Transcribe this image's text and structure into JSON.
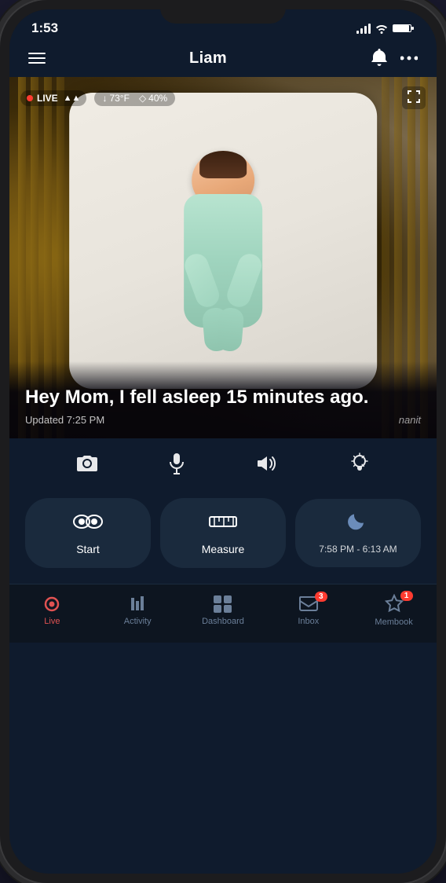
{
  "status_bar": {
    "time": "1:53",
    "signal": true,
    "wifi": true,
    "battery": true
  },
  "header": {
    "title": "Liam",
    "menu_label": "menu",
    "bell_label": "notifications",
    "more_label": "more options"
  },
  "camera": {
    "live_badge": "LIVE",
    "temperature": "73°F",
    "humidity": "40%",
    "message": "Hey Mom, I fell asleep 15 minutes ago.",
    "updated": "Updated 7:25 PM",
    "watermark": "nanit",
    "fullscreen": "fullscreen"
  },
  "controls": {
    "camera_icon": "📷",
    "mic_icon": "🎤",
    "sound_icon": "🔊",
    "light_icon": "💡"
  },
  "action_buttons": {
    "start": {
      "icon": "👁",
      "label": "Start"
    },
    "measure": {
      "icon": "📏",
      "label": "Measure"
    },
    "sleep": {
      "time": "7:58 PM - 6:13 AM"
    }
  },
  "bottom_nav": {
    "items": [
      {
        "icon": "live",
        "label": "Live",
        "active": true,
        "badge": null
      },
      {
        "icon": "activity",
        "label": "Activity",
        "active": false,
        "badge": null
      },
      {
        "icon": "dashboard",
        "label": "Dashboard",
        "active": false,
        "badge": null
      },
      {
        "icon": "inbox",
        "label": "Inbox",
        "active": false,
        "badge": "3"
      },
      {
        "icon": "membook",
        "label": "Membook",
        "active": false,
        "badge": "1"
      }
    ]
  }
}
